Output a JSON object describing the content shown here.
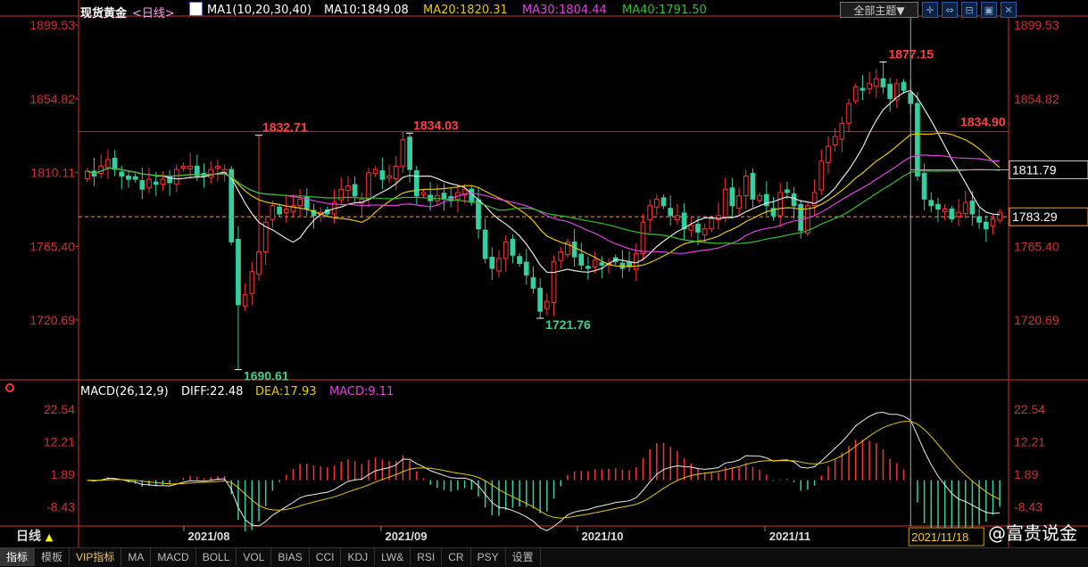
{
  "header": {
    "title": "现货黄金",
    "period_tag": "<日线>",
    "ma_label": "MA1(10,20,30,40)",
    "ma10": "MA10:1849.08",
    "ma20": "MA20:1820.31",
    "ma30": "MA30:1804.44",
    "ma40": "MA40:1791.50",
    "theme_button": "全部主题▼"
  },
  "macd_header": {
    "label": "MACD(26,12,9)",
    "diff": "DIFF:22.48",
    "dea": "DEA:17.93",
    "macd": "MACD:9.11"
  },
  "price_axis": {
    "ticks": [
      "1899.53",
      "1854.82",
      "1810.11",
      "1765.40",
      "1720.69"
    ]
  },
  "macd_axis": {
    "ticks": [
      "22.54",
      "12.21",
      "1.89",
      "-8.43"
    ]
  },
  "date_axis": {
    "labels": [
      "2021/08",
      "2021/09",
      "2021/10",
      "2021/11"
    ],
    "cursor_date": "2021/11/18"
  },
  "annotations": {
    "high_left": "1832.71",
    "high_mid": "1834.03",
    "low_main": "1690.61",
    "low_mid": "1721.76",
    "high_peak": "1877.15"
  },
  "lines": {
    "hline_value": "1834.90",
    "crosshair_value": "1811.79",
    "last_price": "1783.29"
  },
  "tabs": [
    "指标",
    "模板",
    "VIP指标",
    "MA",
    "MACD",
    "BOLL",
    "VOL",
    "BIAS",
    "CCI",
    "KDJ",
    "LW&",
    "RSI",
    "CR",
    "PSY",
    "设置"
  ],
  "period_label": "日线",
  "brand": "@富贵说金",
  "colors": {
    "up": "#ff3232",
    "down": "#32d0a0",
    "ma10": "#e6e6e6",
    "ma20": "#e6c800",
    "ma30": "#e040e0",
    "ma40": "#30c030",
    "axis": "#d03030"
  },
  "chart_data": {
    "type": "candlestick",
    "price_range": [
      1685,
      1905
    ],
    "macd_range": [
      -14,
      26
    ],
    "closes": [
      1811,
      1808,
      1814,
      1818,
      1812,
      1808,
      1806,
      1806,
      1800,
      1806,
      1803,
      1806,
      1804,
      1812,
      1814,
      1814,
      1808,
      1808,
      1812,
      1814,
      1812,
      1768,
      1730,
      1736,
      1750,
      1762,
      1780,
      1790,
      1785,
      1788,
      1790,
      1794,
      1788,
      1784,
      1786,
      1785,
      1792,
      1800,
      1802,
      1796,
      1794,
      1810,
      1812,
      1806,
      1808,
      1814,
      1830,
      1812,
      1796,
      1798,
      1793,
      1796,
      1794,
      1793,
      1798,
      1800,
      1792,
      1776,
      1758,
      1752,
      1758,
      1768,
      1760,
      1755,
      1748,
      1740,
      1726,
      1732,
      1756,
      1762,
      1768,
      1759,
      1754,
      1752,
      1757,
      1754,
      1755,
      1756,
      1752,
      1753,
      1761,
      1780,
      1790,
      1794,
      1790,
      1784,
      1784,
      1776,
      1778,
      1774,
      1776,
      1782,
      1784,
      1800,
      1790,
      1796,
      1808,
      1794,
      1796,
      1790,
      1784,
      1798,
      1798,
      1790,
      1775,
      1790,
      1798,
      1817,
      1826,
      1832,
      1840,
      1852,
      1862,
      1860,
      1864,
      1867,
      1862,
      1855,
      1864,
      1860,
      1852,
      1808,
      1794,
      1790,
      1788,
      1788,
      1782,
      1786,
      1792,
      1785,
      1780,
      1776,
      1782,
      1786
    ]
  }
}
